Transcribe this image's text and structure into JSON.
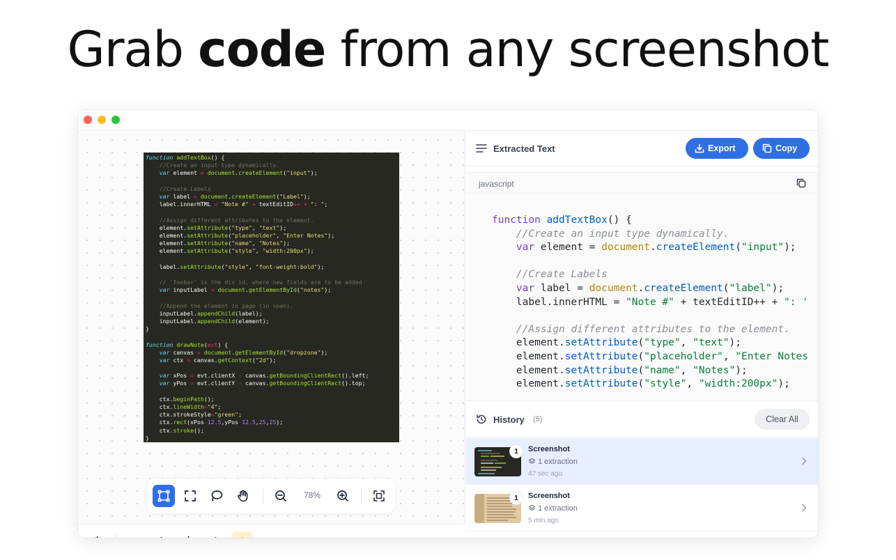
{
  "hero": {
    "prefix": "Grab ",
    "bold": "code",
    "suffix": " from any screenshot"
  },
  "canvas": {
    "screenshot_lines": [
      [
        [
          "kw",
          "function "
        ],
        [
          "fn",
          "addTextBox"
        ],
        [
          "pl",
          "() {"
        ]
      ],
      [
        [
          "pl",
          "    "
        ],
        [
          "cm",
          "//Create an input type dynamically."
        ]
      ],
      [
        [
          "pl",
          "    "
        ],
        [
          "kw",
          "var "
        ],
        [
          "pl",
          "element "
        ],
        [
          "op",
          "= "
        ],
        [
          "fn",
          "document"
        ],
        [
          "pl",
          "."
        ],
        [
          "fn",
          "createElement"
        ],
        [
          "pl",
          "("
        ],
        [
          "str",
          "\"input\""
        ],
        [
          "pl",
          ");"
        ]
      ],
      [
        [
          "pl",
          ""
        ]
      ],
      [
        [
          "pl",
          "    "
        ],
        [
          "cm",
          "//Create Labels"
        ]
      ],
      [
        [
          "pl",
          "    "
        ],
        [
          "kw",
          "var "
        ],
        [
          "pl",
          "label "
        ],
        [
          "op",
          "= "
        ],
        [
          "fn",
          "document"
        ],
        [
          "pl",
          "."
        ],
        [
          "fn",
          "createElement"
        ],
        [
          "pl",
          "("
        ],
        [
          "str",
          "\"Label\""
        ],
        [
          "pl",
          ");"
        ]
      ],
      [
        [
          "pl",
          "    label.innerHTML "
        ],
        [
          "op",
          "= "
        ],
        [
          "str",
          "\"Note #\" "
        ],
        [
          "op",
          "+ "
        ],
        [
          "pl",
          "textEditID"
        ],
        [
          "op",
          "++ + "
        ],
        [
          "str",
          "\": \""
        ],
        [
          "pl",
          ";"
        ]
      ],
      [
        [
          "pl",
          ""
        ]
      ],
      [
        [
          "pl",
          "    "
        ],
        [
          "cm",
          "//Assign different attributes to the element."
        ]
      ],
      [
        [
          "pl",
          "    element."
        ],
        [
          "fn",
          "setAttribute"
        ],
        [
          "pl",
          "("
        ],
        [
          "str",
          "\"type\""
        ],
        [
          "pl",
          ", "
        ],
        [
          "str",
          "\"text\""
        ],
        [
          "pl",
          ");"
        ]
      ],
      [
        [
          "pl",
          "    element."
        ],
        [
          "fn",
          "setAttribute"
        ],
        [
          "pl",
          "("
        ],
        [
          "str",
          "\"placeholder\""
        ],
        [
          "pl",
          ", "
        ],
        [
          "str",
          "\"Enter Notes\""
        ],
        [
          "pl",
          ");"
        ]
      ],
      [
        [
          "pl",
          "    element."
        ],
        [
          "fn",
          "setAttribute"
        ],
        [
          "pl",
          "("
        ],
        [
          "str",
          "\"name\""
        ],
        [
          "pl",
          ", "
        ],
        [
          "str",
          "\"Notes\""
        ],
        [
          "pl",
          ");"
        ]
      ],
      [
        [
          "pl",
          "    element."
        ],
        [
          "fn",
          "setAttribute"
        ],
        [
          "pl",
          "("
        ],
        [
          "str",
          "\"style\""
        ],
        [
          "pl",
          ", "
        ],
        [
          "str",
          "\"width:200px\""
        ],
        [
          "pl",
          ");"
        ]
      ],
      [
        [
          "pl",
          ""
        ]
      ],
      [
        [
          "pl",
          "    label."
        ],
        [
          "fn",
          "setAttribute"
        ],
        [
          "pl",
          "("
        ],
        [
          "str",
          "\"style\""
        ],
        [
          "pl",
          ", "
        ],
        [
          "str",
          "\"font-weight:bold\""
        ],
        [
          "pl",
          ");"
        ]
      ],
      [
        [
          "pl",
          ""
        ]
      ],
      [
        [
          "pl",
          "    "
        ],
        [
          "cm",
          "// 'foobar' is the div id, where new fields are to be added"
        ]
      ],
      [
        [
          "pl",
          "    "
        ],
        [
          "kw",
          "var "
        ],
        [
          "pl",
          "inputLabel "
        ],
        [
          "op",
          "= "
        ],
        [
          "fn",
          "document"
        ],
        [
          "pl",
          "."
        ],
        [
          "fn",
          "getElementById"
        ],
        [
          "pl",
          "("
        ],
        [
          "str",
          "\"notes\""
        ],
        [
          "pl",
          ");"
        ]
      ],
      [
        [
          "pl",
          ""
        ]
      ],
      [
        [
          "pl",
          "    "
        ],
        [
          "cm",
          "//Append the element in page (in span)."
        ]
      ],
      [
        [
          "pl",
          "    inputLabel."
        ],
        [
          "fn",
          "appendChild"
        ],
        [
          "pl",
          "(label);"
        ]
      ],
      [
        [
          "pl",
          "    inputLabel."
        ],
        [
          "fn",
          "appendChild"
        ],
        [
          "pl",
          "(element);"
        ]
      ],
      [
        [
          "pl",
          "}"
        ]
      ],
      [
        [
          "pl",
          ""
        ]
      ],
      [
        [
          "kw",
          "function "
        ],
        [
          "fn",
          "drawNote"
        ],
        [
          "pl",
          "("
        ],
        [
          "op",
          "evt"
        ],
        [
          "pl",
          ") {"
        ]
      ],
      [
        [
          "pl",
          "    "
        ],
        [
          "kw",
          "var "
        ],
        [
          "pl",
          "canvas "
        ],
        [
          "op",
          "= "
        ],
        [
          "fn",
          "document"
        ],
        [
          "pl",
          "."
        ],
        [
          "fn",
          "getElementById"
        ],
        [
          "pl",
          "("
        ],
        [
          "str",
          "\"dropzone\""
        ],
        [
          "pl",
          ");"
        ]
      ],
      [
        [
          "pl",
          "    "
        ],
        [
          "kw",
          "var "
        ],
        [
          "pl",
          "ctx "
        ],
        [
          "op",
          "= "
        ],
        [
          "pl",
          "canvas."
        ],
        [
          "fn",
          "getContext"
        ],
        [
          "pl",
          "("
        ],
        [
          "str",
          "\"2d\""
        ],
        [
          "pl",
          ");"
        ]
      ],
      [
        [
          "pl",
          ""
        ]
      ],
      [
        [
          "pl",
          "    "
        ],
        [
          "kw",
          "var "
        ],
        [
          "pl",
          "xPos "
        ],
        [
          "op",
          "= "
        ],
        [
          "pl",
          "evt.clientX "
        ],
        [
          "op",
          "- "
        ],
        [
          "pl",
          "canvas."
        ],
        [
          "fn",
          "getBoundingClientRect"
        ],
        [
          "pl",
          "().left;"
        ]
      ],
      [
        [
          "pl",
          "    "
        ],
        [
          "kw",
          "var "
        ],
        [
          "pl",
          "yPos "
        ],
        [
          "op",
          "= "
        ],
        [
          "pl",
          "evt.clientY "
        ],
        [
          "op",
          "- "
        ],
        [
          "pl",
          "canvas."
        ],
        [
          "fn",
          "getBoundingClientRect"
        ],
        [
          "pl",
          "().top;"
        ]
      ],
      [
        [
          "pl",
          ""
        ]
      ],
      [
        [
          "pl",
          "    ctx."
        ],
        [
          "fn",
          "beginPath"
        ],
        [
          "pl",
          "();"
        ]
      ],
      [
        [
          "pl",
          "    ctx."
        ],
        [
          "fn",
          "lineWidth"
        ],
        [
          "op",
          "="
        ],
        [
          "str",
          "\"4\""
        ],
        [
          "pl",
          ";"
        ]
      ],
      [
        [
          "pl",
          "    ctx.strokeStyle"
        ],
        [
          "op",
          "="
        ],
        [
          "str",
          "\"green\""
        ],
        [
          "pl",
          ";"
        ]
      ],
      [
        [
          "pl",
          "    ctx."
        ],
        [
          "fn",
          "rect"
        ],
        [
          "pl",
          "(xPos"
        ],
        [
          "op",
          "-"
        ],
        [
          "num",
          "12.5"
        ],
        [
          "pl",
          ",yPos"
        ],
        [
          "op",
          "-"
        ],
        [
          "num",
          "12.5"
        ],
        [
          "pl",
          ","
        ],
        [
          "num",
          "25"
        ],
        [
          "pl",
          ","
        ],
        [
          "num",
          "25"
        ],
        [
          "pl",
          ");"
        ]
      ],
      [
        [
          "pl",
          "    ctx."
        ],
        [
          "fn",
          "stroke"
        ],
        [
          "pl",
          "();"
        ]
      ],
      [
        [
          "pl",
          "}"
        ]
      ]
    ],
    "zoom_label": "78%"
  },
  "panel": {
    "title": "Extracted Text",
    "export_label": "Export",
    "copy_label": "Copy",
    "language": "javascript",
    "code_lines": [
      [
        [
          "kw",
          "function "
        ],
        [
          "fn",
          "addTextBox"
        ],
        [
          "pl",
          "() {"
        ]
      ],
      [
        [
          "pl",
          "    "
        ],
        [
          "cm",
          "//Create an input type dynamically."
        ]
      ],
      [
        [
          "pl",
          "    "
        ],
        [
          "kw",
          "var "
        ],
        [
          "pl",
          "element = "
        ],
        [
          "obj",
          "document"
        ],
        [
          "pl",
          "."
        ],
        [
          "fn",
          "createElement"
        ],
        [
          "pl",
          "("
        ],
        [
          "str",
          "\"input\""
        ],
        [
          "pl",
          ");"
        ]
      ],
      [
        [
          "pl",
          ""
        ]
      ],
      [
        [
          "pl",
          "    "
        ],
        [
          "cm",
          "//Create Labels"
        ]
      ],
      [
        [
          "pl",
          "    "
        ],
        [
          "kw",
          "var "
        ],
        [
          "pl",
          "label = "
        ],
        [
          "obj",
          "document"
        ],
        [
          "pl",
          "."
        ],
        [
          "fn",
          "createElement"
        ],
        [
          "pl",
          "("
        ],
        [
          "str",
          "\"label\""
        ],
        [
          "pl",
          ");"
        ]
      ],
      [
        [
          "pl",
          "    label.innerHTML = "
        ],
        [
          "str",
          "\"Note #\""
        ],
        [
          "pl",
          " + textEditID++ + "
        ],
        [
          "str",
          "\": '"
        ]
      ],
      [
        [
          "pl",
          ""
        ]
      ],
      [
        [
          "pl",
          "    "
        ],
        [
          "cm",
          "//Assign different attributes to the element."
        ]
      ],
      [
        [
          "pl",
          "    element."
        ],
        [
          "fn",
          "setAttribute"
        ],
        [
          "pl",
          "("
        ],
        [
          "str",
          "\"type\""
        ],
        [
          "pl",
          ", "
        ],
        [
          "str",
          "\"text\""
        ],
        [
          "pl",
          ");"
        ]
      ],
      [
        [
          "pl",
          "    element."
        ],
        [
          "fn",
          "setAttribute"
        ],
        [
          "pl",
          "("
        ],
        [
          "str",
          "\"placeholder\""
        ],
        [
          "pl",
          ", "
        ],
        [
          "str",
          "\"Enter Notes"
        ]
      ],
      [
        [
          "pl",
          "    element."
        ],
        [
          "fn",
          "setAttribute"
        ],
        [
          "pl",
          "("
        ],
        [
          "str",
          "\"name\""
        ],
        [
          "pl",
          ", "
        ],
        [
          "str",
          "\"Notes\""
        ],
        [
          "pl",
          ");"
        ]
      ],
      [
        [
          "pl",
          "    element."
        ],
        [
          "fn",
          "setAttribute"
        ],
        [
          "pl",
          "("
        ],
        [
          "str",
          "\"style\""
        ],
        [
          "pl",
          ", "
        ],
        [
          "str",
          "\"width:200px\""
        ],
        [
          "pl",
          ");"
        ]
      ]
    ]
  },
  "history": {
    "title": "History",
    "count": "(5)",
    "clear_label": "Clear All",
    "items": [
      {
        "badge": "1",
        "title": "Screenshot",
        "extraction": "1 extraction",
        "time": "47 sec ago"
      },
      {
        "badge": "1",
        "title": "Screenshot",
        "extraction": "1 extraction",
        "time": "5 min ago"
      }
    ]
  },
  "colors": {
    "accent": "#2f6fe4",
    "selected_row": "#e5efff",
    "code_bg": "#272822",
    "crown": "#fdf3cf"
  }
}
